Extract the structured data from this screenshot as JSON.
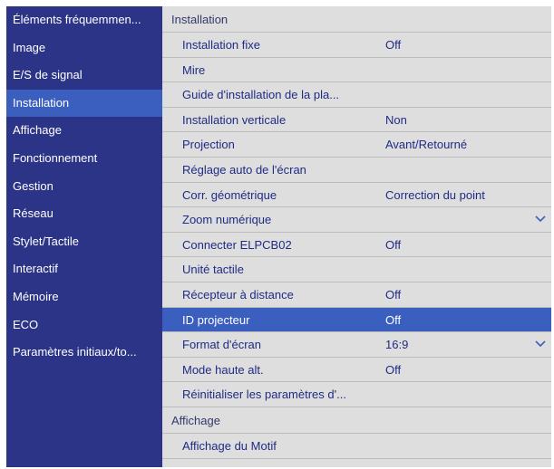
{
  "sidebar": {
    "items": [
      {
        "label": "Éléments fréquemmen...",
        "active": false
      },
      {
        "label": "Image",
        "active": false
      },
      {
        "label": "E/S de signal",
        "active": false
      },
      {
        "label": "Installation",
        "active": true
      },
      {
        "label": "Affichage",
        "active": false
      },
      {
        "label": "Fonctionnement",
        "active": false
      },
      {
        "label": "Gestion",
        "active": false
      },
      {
        "label": "Réseau",
        "active": false
      },
      {
        "label": "Stylet/Tactile",
        "active": false
      },
      {
        "label": "Interactif",
        "active": false
      },
      {
        "label": "Mémoire",
        "active": false
      },
      {
        "label": "ECO",
        "active": false
      },
      {
        "label": "Paramètres initiaux/to...",
        "active": false
      }
    ]
  },
  "main": {
    "section_installation": "Installation",
    "rows": [
      {
        "label": "Installation fixe",
        "value": "Off",
        "chevron": false,
        "selected": false
      },
      {
        "label": "Mire",
        "value": "",
        "chevron": false,
        "selected": false
      },
      {
        "label": "Guide d'installation de la pla...",
        "value": "",
        "chevron": false,
        "selected": false
      },
      {
        "label": "Installation verticale",
        "value": "Non",
        "chevron": false,
        "selected": false
      },
      {
        "label": "Projection",
        "value": "Avant/Retourné",
        "chevron": false,
        "selected": false
      },
      {
        "label": "Réglage auto de l'écran",
        "value": "",
        "chevron": false,
        "selected": false
      },
      {
        "label": "Corr. géométrique",
        "value": "Correction du point",
        "chevron": false,
        "selected": false
      },
      {
        "label": "Zoom numérique",
        "value": "",
        "chevron": true,
        "selected": false
      },
      {
        "label": "Connecter ELPCB02",
        "value": "Off",
        "chevron": false,
        "selected": false
      },
      {
        "label": "Unité tactile",
        "value": "",
        "chevron": false,
        "selected": false
      },
      {
        "label": "Récepteur à distance",
        "value": "Off",
        "chevron": false,
        "selected": false
      },
      {
        "label": "ID projecteur",
        "value": "Off",
        "chevron": false,
        "selected": true
      },
      {
        "label": "Format d'écran",
        "value": "16:9",
        "chevron": true,
        "selected": false
      },
      {
        "label": "Mode haute alt.",
        "value": "Off",
        "chevron": false,
        "selected": false
      },
      {
        "label": "Réinitialiser les paramètres d'...",
        "value": "",
        "chevron": false,
        "selected": false
      }
    ],
    "section_affichage": "Affichage",
    "affichage_rows": [
      {
        "label": "Affichage du Motif",
        "value": ""
      }
    ]
  },
  "colors": {
    "sidebar_bg": "#2c3487",
    "highlight": "#3b5fbf",
    "panel_bg": "#dedede",
    "item_text": "#1f2b84"
  }
}
